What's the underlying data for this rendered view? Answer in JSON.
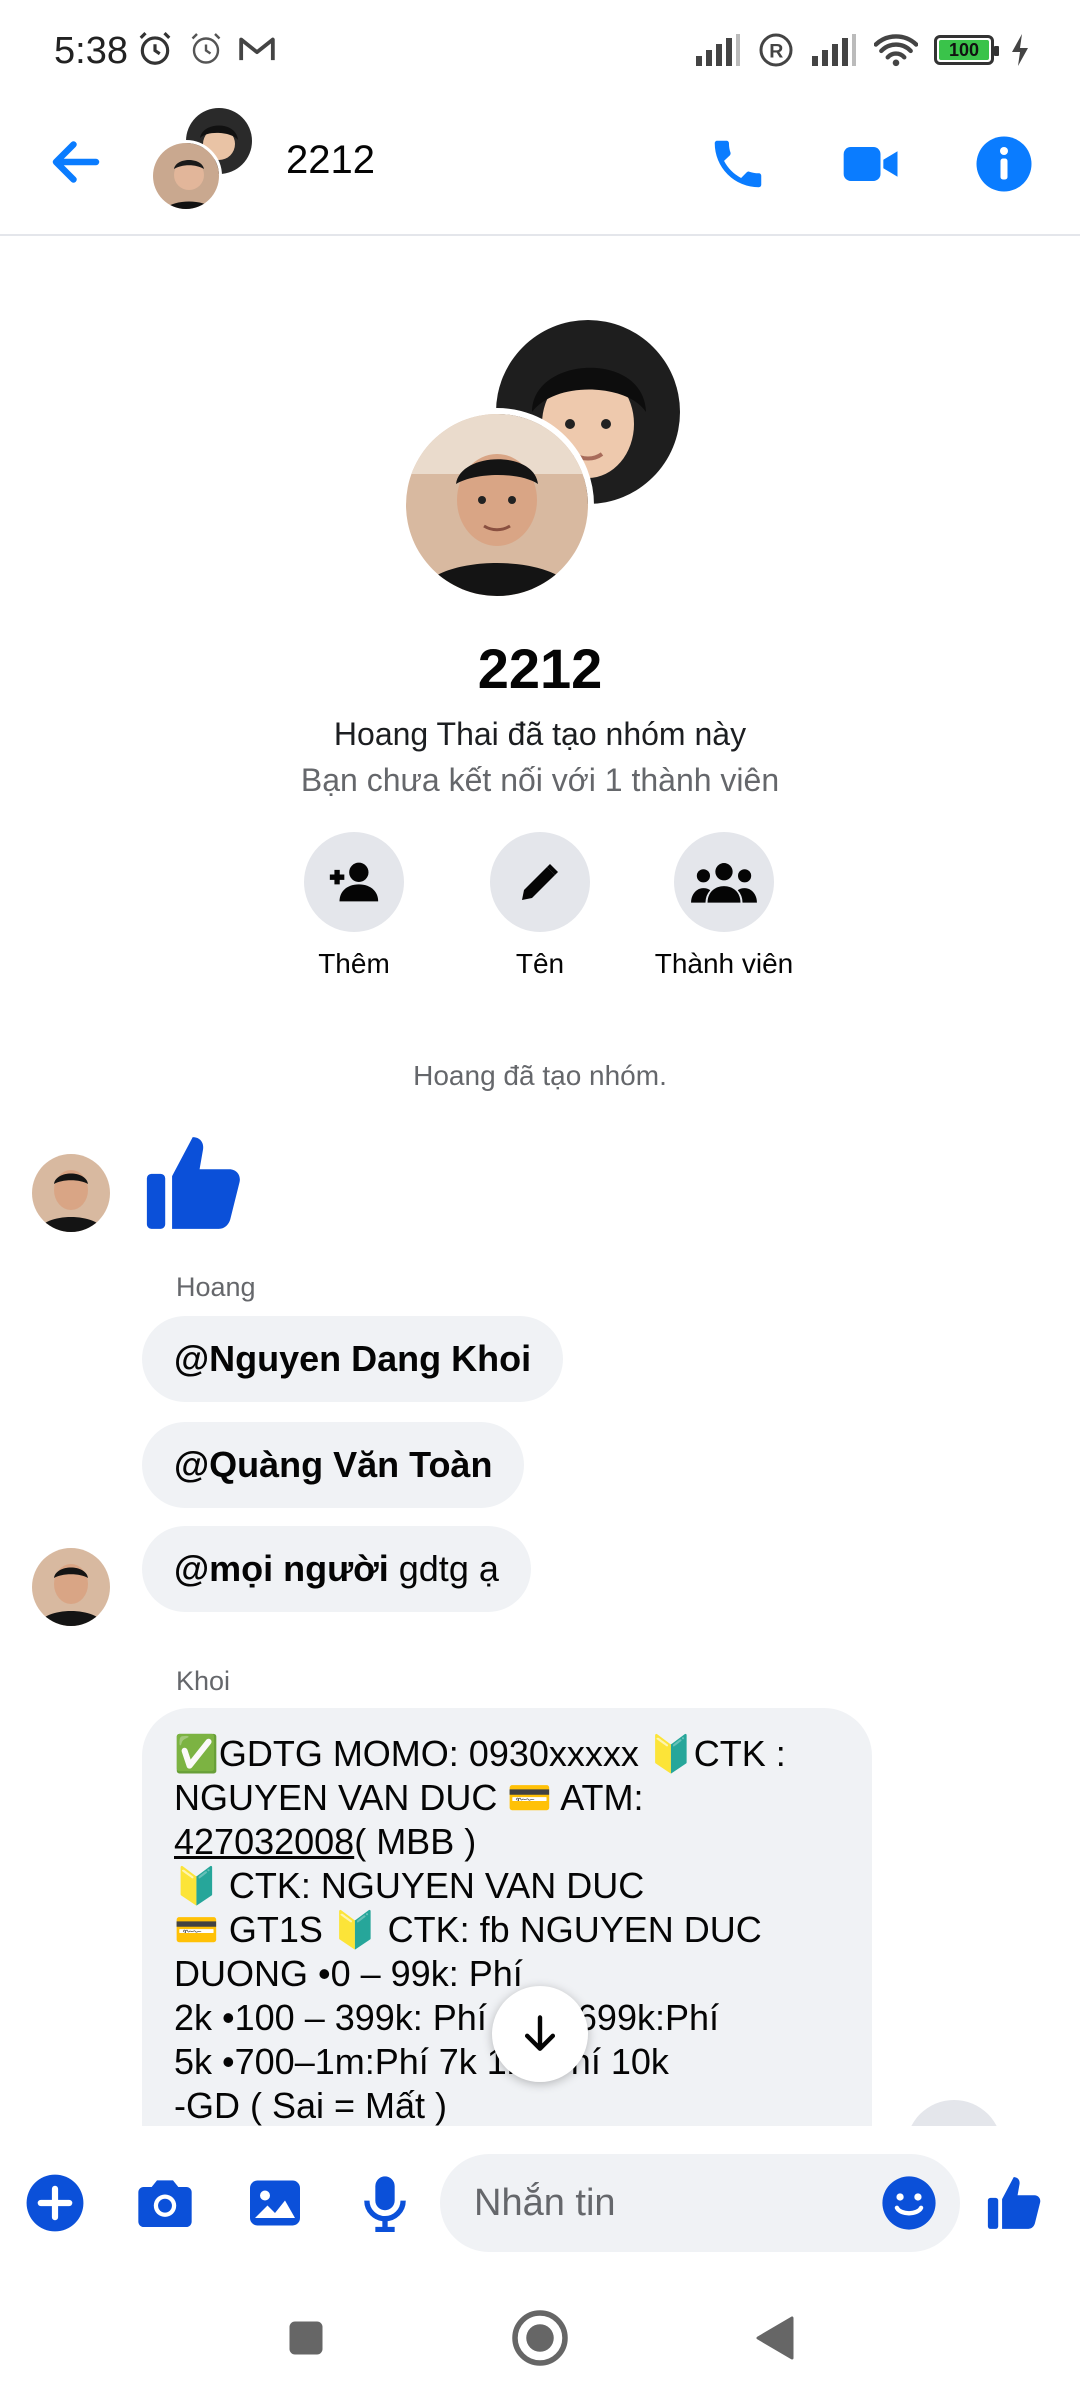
{
  "status_bar": {
    "time": "5:38",
    "battery": "100"
  },
  "header": {
    "title": "2212"
  },
  "group": {
    "name": "2212",
    "created_by": "Hoang Thai đã tạo nhóm này",
    "connection": "Bạn chưa kết nối với 1 thành viên",
    "actions": [
      {
        "label": "Thêm",
        "icon": "add-person-icon"
      },
      {
        "label": "Tên",
        "icon": "pencil-icon"
      },
      {
        "label": "Thành viên",
        "icon": "group-icon"
      }
    ]
  },
  "system_message": "Hoang đã tạo nhóm.",
  "messages": {
    "sender1": "Hoang",
    "m1_mention": "@Nguyen Dang Khoi",
    "m2_mention": "@Quàng Văn Toàn",
    "m3_mention": "@mọi người",
    "m3_text": " gdtg ạ",
    "sender2": "Khoi",
    "long": {
      "l1": "✅GDTG  MOMO: 0930xxxxx 🔰CTK :",
      "l2": "NGUYEN VAN DUC 💳 ATM:",
      "l3_link": "427032008",
      "l3_rest": "( MBB )",
      "l4": "🔰 CTK: NGUYEN VAN DUC",
      "l5": "💳 GT1S 🔰 CTK: fb NGUYEN DUC",
      "l6": "DUONG                         •0 – 99k: Phí",
      "l7": "2k •100 – 399k: Phí      400–699k:Phí",
      "l8": "5k •700–1m:Phí 7k       1m:Phí 10k",
      "l9": "-GD ( Sai = Mất )"
    }
  },
  "composer": {
    "placeholder": "Nhắn tin"
  },
  "colors": {
    "accent": "#0a7cff",
    "like": "#0b50d9",
    "bubble": "#f0f2f5"
  }
}
